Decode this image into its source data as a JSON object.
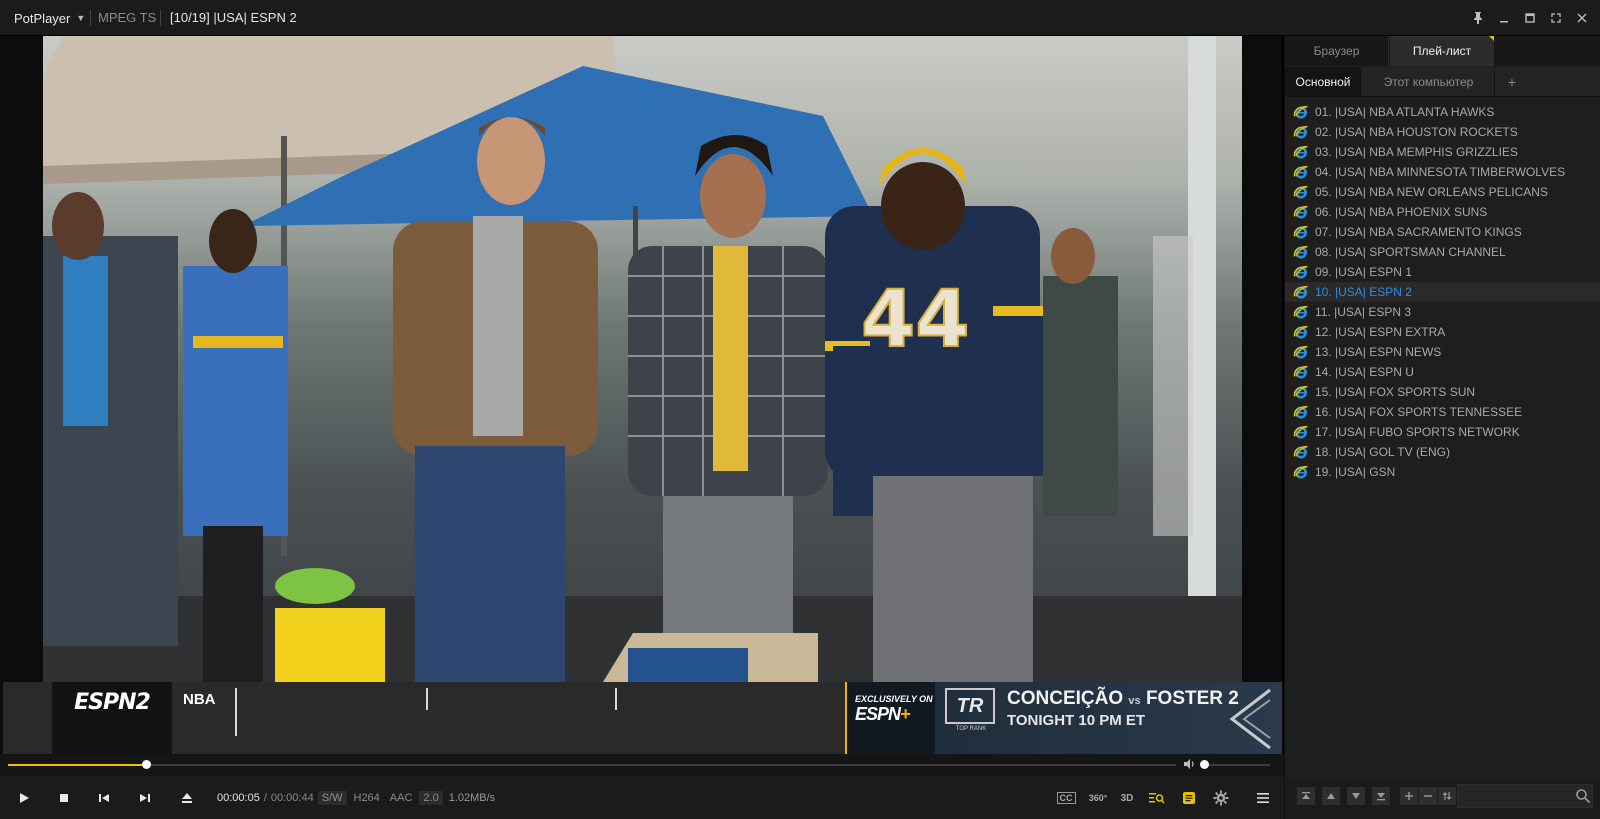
{
  "titlebar": {
    "app_name": "PotPlayer",
    "format": "MPEG TS",
    "title": "[10/19] |USA| ESPN 2"
  },
  "video": {
    "channel_logo": "ESPN2",
    "league": "NBA",
    "promo": {
      "exclusive_line1": "EXCLUSIVELY ON",
      "exclusive_line2": "ESPN",
      "exclusive_plus": "+",
      "brand": "TR",
      "brand_sub": "TOP RANK",
      "matchup_a": "CONCEIÇÃO",
      "matchup_vs": "vs",
      "matchup_b": "FOSTER 2",
      "time": "TONIGHT 10 PM ET"
    },
    "jersey_number": "44"
  },
  "playback": {
    "position_fraction": 0.118,
    "volume_fraction": 0.03,
    "current_time": "00:00:05",
    "separator": "/",
    "duration": "00:00:44",
    "decoder": "S/W",
    "video_codec": "H264",
    "audio_codec": "AAC",
    "channels": "2.0",
    "bitrate": "1.02MB/s"
  },
  "controls": {
    "play_icon": "play-icon",
    "stop_icon": "stop-icon",
    "prev_icon": "previous-icon",
    "next_icon": "next-icon",
    "eject_icon": "eject-icon",
    "cc_label": "CC",
    "vr_label": "360°",
    "threed_label": "3D",
    "menu_icon": "hamburger-icon"
  },
  "panel": {
    "tabs": [
      {
        "label": "Браузер"
      },
      {
        "label": "Плей-лист"
      }
    ],
    "subtabs": [
      {
        "label": "Основной"
      },
      {
        "label": "Этот компьютер"
      },
      {
        "label": "+"
      }
    ],
    "playlist": [
      {
        "label": "01. |USA| NBA ATLANTA HAWKS"
      },
      {
        "label": "02. |USA| NBA HOUSTON ROCKETS"
      },
      {
        "label": "03. |USA| NBA MEMPHIS GRIZZLIES"
      },
      {
        "label": "04. |USA| NBA MINNESOTA TIMBERWOLVES"
      },
      {
        "label": "05. |USA| NBA NEW ORLEANS PELICANS"
      },
      {
        "label": "06. |USA| NBA PHOENIX SUNS"
      },
      {
        "label": "07. |USA| NBA SACRAMENTO KINGS"
      },
      {
        "label": "08. |USA| SPORTSMAN CHANNEL"
      },
      {
        "label": "09. |USA| ESPN 1"
      },
      {
        "label": "10. |USA| ESPN 2",
        "active": true
      },
      {
        "label": "11. |USA| ESPN 3"
      },
      {
        "label": "12. |USA| ESPN EXTRA"
      },
      {
        "label": "13. |USA| ESPN NEWS"
      },
      {
        "label": "14. |USA| ESPN U"
      },
      {
        "label": "15. |USA| FOX SPORTS SUN"
      },
      {
        "label": "16. |USA| FOX SPORTS TENNESSEE"
      },
      {
        "label": "17. |USA| FUBO SPORTS NETWORK"
      },
      {
        "label": "18. |USA| GOL TV (ENG)"
      },
      {
        "label": "19. |USA| GSN"
      }
    ],
    "footer": {
      "search_value": ""
    }
  },
  "colors": {
    "accent": "#e6c200",
    "active_item": "#2e8ce6",
    "background": "#1b1b1b"
  }
}
